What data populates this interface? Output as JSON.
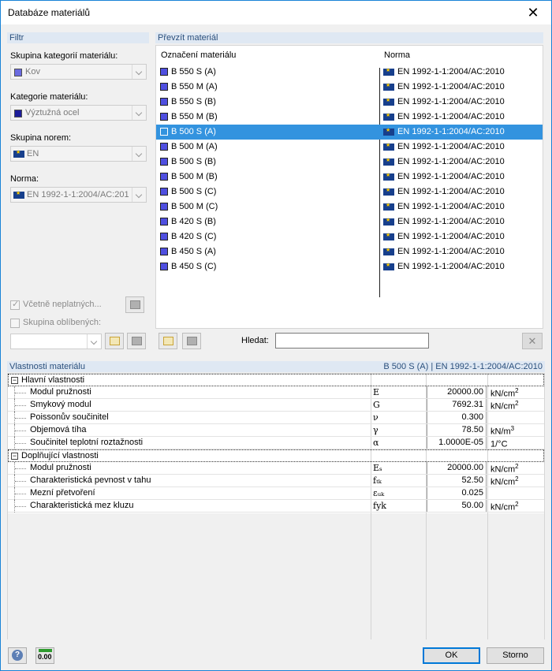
{
  "window": {
    "title": "Databáze materiálů",
    "close": "✕"
  },
  "filter": {
    "section_title": "Filtr",
    "group_label": "Skupina kategorií materiálu:",
    "group_value": "Kov",
    "category_label": "Kategorie materiálu:",
    "category_value": "Výztužná ocel",
    "norm_group_label": "Skupina norem:",
    "norm_group_value": "EN",
    "norm_label": "Norma:",
    "norm_value": "EN 1992-1-1:2004/AC:201",
    "include_invalid": "Včetně neplatných...",
    "favorites": "Skupina oblíbených:"
  },
  "materials": {
    "section_title": "Převzít materiál",
    "col_name": "Označení materiálu",
    "col_norm": "Norma",
    "rows": [
      {
        "name": "B 550 S (A)",
        "norm": "EN 1992-1-1:2004/AC:2010"
      },
      {
        "name": "B 550 M (A)",
        "norm": "EN 1992-1-1:2004/AC:2010"
      },
      {
        "name": "B 550 S (B)",
        "norm": "EN 1992-1-1:2004/AC:2010"
      },
      {
        "name": "B 550 M (B)",
        "norm": "EN 1992-1-1:2004/AC:2010"
      },
      {
        "name": "B 500 S (A)",
        "norm": "EN 1992-1-1:2004/AC:2010"
      },
      {
        "name": "B 500 M (A)",
        "norm": "EN 1992-1-1:2004/AC:2010"
      },
      {
        "name": "B 500 S (B)",
        "norm": "EN 1992-1-1:2004/AC:2010"
      },
      {
        "name": "B 500 M (B)",
        "norm": "EN 1992-1-1:2004/AC:2010"
      },
      {
        "name": "B 500 S (C)",
        "norm": "EN 1992-1-1:2004/AC:2010"
      },
      {
        "name": "B 500 M (C)",
        "norm": "EN 1992-1-1:2004/AC:2010"
      },
      {
        "name": "B 420 S (B)",
        "norm": "EN 1992-1-1:2004/AC:2010"
      },
      {
        "name": "B 420 S (C)",
        "norm": "EN 1992-1-1:2004/AC:2010"
      },
      {
        "name": "B 450 S (A)",
        "norm": "EN 1992-1-1:2004/AC:2010"
      },
      {
        "name": "B 450 S (C)",
        "norm": "EN 1992-1-1:2004/AC:2010"
      }
    ],
    "selected_index": 4,
    "search_label": "Hledat:",
    "search_value": ""
  },
  "properties": {
    "section_title": "Vlastnosti materiálu",
    "selected_summary": "B 500 S (A)  |  EN 1992-1-1:2004/AC:2010",
    "main_title": "Hlavní vlastnosti",
    "main": [
      {
        "name": "Modul pružnosti",
        "sym": "E",
        "value": "20000.00",
        "unit": "kN/cm",
        "sup": "2"
      },
      {
        "name": "Smykový modul",
        "sym": "G",
        "value": "7692.31",
        "unit": "kN/cm",
        "sup": "2"
      },
      {
        "name": "Poissonův součinitel",
        "sym": "ν",
        "value": "0.300",
        "unit": "",
        "sup": ""
      },
      {
        "name": "Objemová tíha",
        "sym": "γ",
        "value": "78.50",
        "unit": "kN/m",
        "sup": "3"
      },
      {
        "name": "Součinitel teplotní roztažnosti",
        "sym": "α",
        "value": "1.0000E-05",
        "unit": "1/°C",
        "sup": ""
      }
    ],
    "extra_title": "Doplňující vlastnosti",
    "extra": [
      {
        "name": "Modul pružnosti",
        "sym": "Eₛ",
        "value": "20000.00",
        "unit": "kN/cm",
        "sup": "2"
      },
      {
        "name": "Charakteristická pevnost v tahu",
        "sym": "fₜₖ",
        "value": "52.50",
        "unit": "kN/cm",
        "sup": "2"
      },
      {
        "name": "Mezní přetvoření",
        "sym": "εᵤₖ",
        "value": "0.025",
        "unit": "",
        "sup": ""
      },
      {
        "name": "Charakteristická mez kluzu",
        "sym": "fyk",
        "value": "50.00",
        "unit": "kN/cm",
        "sup": "2"
      }
    ]
  },
  "footer": {
    "ok": "OK",
    "cancel": "Storno",
    "units_icon_text": "0.00"
  }
}
